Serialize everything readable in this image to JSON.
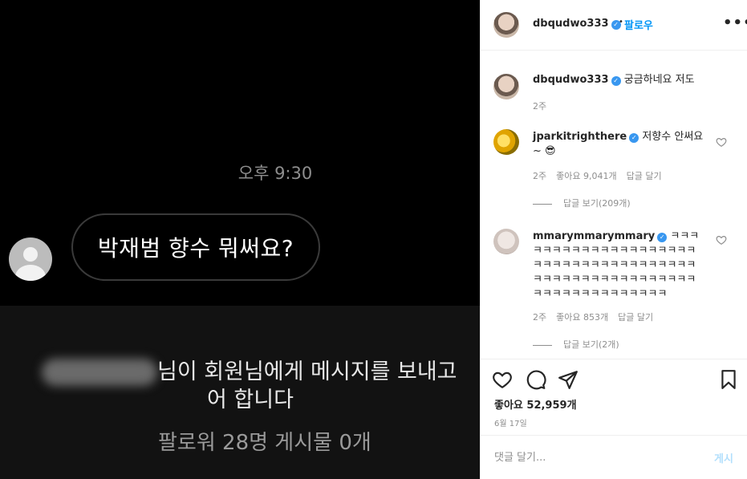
{
  "photo": {
    "timestamp": "오후 9:30",
    "bubble_text": "박재범 향수 뭐써요?",
    "notice_line1": "님이 회원님에게 메시지를 보내고",
    "notice_line2": "어 합니다",
    "followers_text": "팔로워 28명 게시물 0개"
  },
  "post": {
    "username": "dbqudwo333",
    "follow_label": "팔로우",
    "more_icon": "more-horizontal-icon",
    "caption": "궁금하네요 저도",
    "caption_age": "2주",
    "likes": "좋아요 52,959개",
    "date": "6월 17일"
  },
  "comments": [
    {
      "username": "jparkitrighthere",
      "text": "저향수 안써요 ~ 😎",
      "age": "2주",
      "likes": "좋아요 9,041개",
      "reply": "답글 달기",
      "view_replies": "답글 보기(209개)"
    },
    {
      "username": "mmarymmarymmary",
      "text": "ㅋㅋㅋㅋㅋㅋㅋㅋㅋㅋㅋㅋㅋㅋㅋㅋㅋㅋㅋㅋㅋㅋㅋㅋㅋㅋㅋㅋㅋㅋㅋㅋㅋㅋㅋㅋㅋㅋㅋㅋㅋㅋㅋㅋㅋㅋㅋㅋㅋㅋㅋㅋㅋㅋㅋㅋㅋㅋㅋㅋㅋㅋㅋㅋㅋㅋㅋㅋ",
      "age": "2주",
      "likes": "좋아요 853개",
      "reply": "답글 달기",
      "view_replies": "답글 보기(2개)"
    }
  ],
  "compose": {
    "placeholder": "댓글 달기...",
    "post_label": "게시"
  },
  "colors": {
    "accent": "#0095f6",
    "verified": "#3897f0",
    "muted": "#8e8e8e"
  }
}
